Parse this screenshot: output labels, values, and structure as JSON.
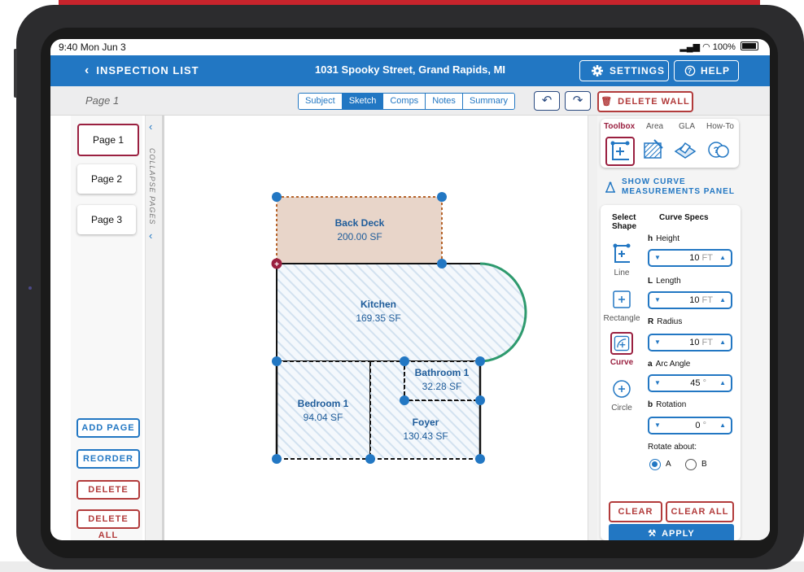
{
  "status": {
    "time": "9:40 Mon Jun 3",
    "battery": "100%"
  },
  "nav": {
    "back_label": "INSPECTION LIST",
    "title": "1031 Spooky Street, Grand Rapids, MI",
    "settings_label": "SETTINGS",
    "help_label": "HELP"
  },
  "subbar": {
    "page_label": "Page 1",
    "tabs": [
      {
        "label": "Subject"
      },
      {
        "label": "Sketch",
        "active": true
      },
      {
        "label": "Comps"
      },
      {
        "label": "Notes"
      },
      {
        "label": "Summary"
      }
    ],
    "undo_icon": "undo-icon",
    "redo_icon": "redo-icon",
    "delete_wall_label": "DELETE WALL"
  },
  "pages": [
    {
      "label": "Page 1",
      "selected": true
    },
    {
      "label": "Page 2"
    },
    {
      "label": "Page 3"
    }
  ],
  "collapse_label": "COLLAPSE PAGES",
  "page_actions": {
    "add": "ADD PAGE",
    "reorder": "REORDER",
    "delete": "DELETE",
    "delete_all": "DELETE ALL"
  },
  "rooms": [
    {
      "name": "Back Deck",
      "area": "200.00 SF"
    },
    {
      "name": "Kitchen",
      "area": "169.35 SF"
    },
    {
      "name": "Bathroom 1",
      "area": "32.28 SF"
    },
    {
      "name": "Bedroom 1",
      "area": "94.04 SF"
    },
    {
      "name": "Foyer",
      "area": "130.43 SF"
    }
  ],
  "toolbox": {
    "tabs": [
      "Toolbox",
      "Area",
      "GLA",
      "How-To"
    ],
    "active_tab": "Toolbox"
  },
  "show_curve_label_1": "SHOW CURVE",
  "show_curve_label_2": "MEASUREMENTS PANEL",
  "select_shape": {
    "heading_1": "Select",
    "heading_2": "Shape",
    "shapes": [
      "Line",
      "Rectangle",
      "Curve",
      "Circle"
    ],
    "selected": "Curve"
  },
  "curve_specs": {
    "heading": "Curve Specs",
    "height": {
      "key": "h",
      "label": "Height",
      "value": "10",
      "unit": "FT"
    },
    "length": {
      "key": "L",
      "label": "Length",
      "value": "10",
      "unit": "FT"
    },
    "radius": {
      "key": "R",
      "label": "Radius",
      "value": "10",
      "unit": "FT"
    },
    "arc_angle": {
      "key": "a",
      "label": "Arc Angle",
      "value": "45",
      "unit": "°"
    },
    "rotation": {
      "key": "b",
      "label": "Rotation",
      "value": "0",
      "unit": "°"
    },
    "rotate_about_label": "Rotate about:",
    "rotate_options": [
      "A",
      "B"
    ],
    "rotate_selected": "A"
  },
  "buttons": {
    "clear": "CLEAR",
    "clear_all": "CLEAR ALL",
    "apply": "APPLY"
  },
  "colors": {
    "primary": "#2277c3",
    "danger": "#b23b3b",
    "selected": "#9a2040",
    "deck_fill": "#e8d5c9",
    "curve_stroke": "#2e9a6e"
  }
}
